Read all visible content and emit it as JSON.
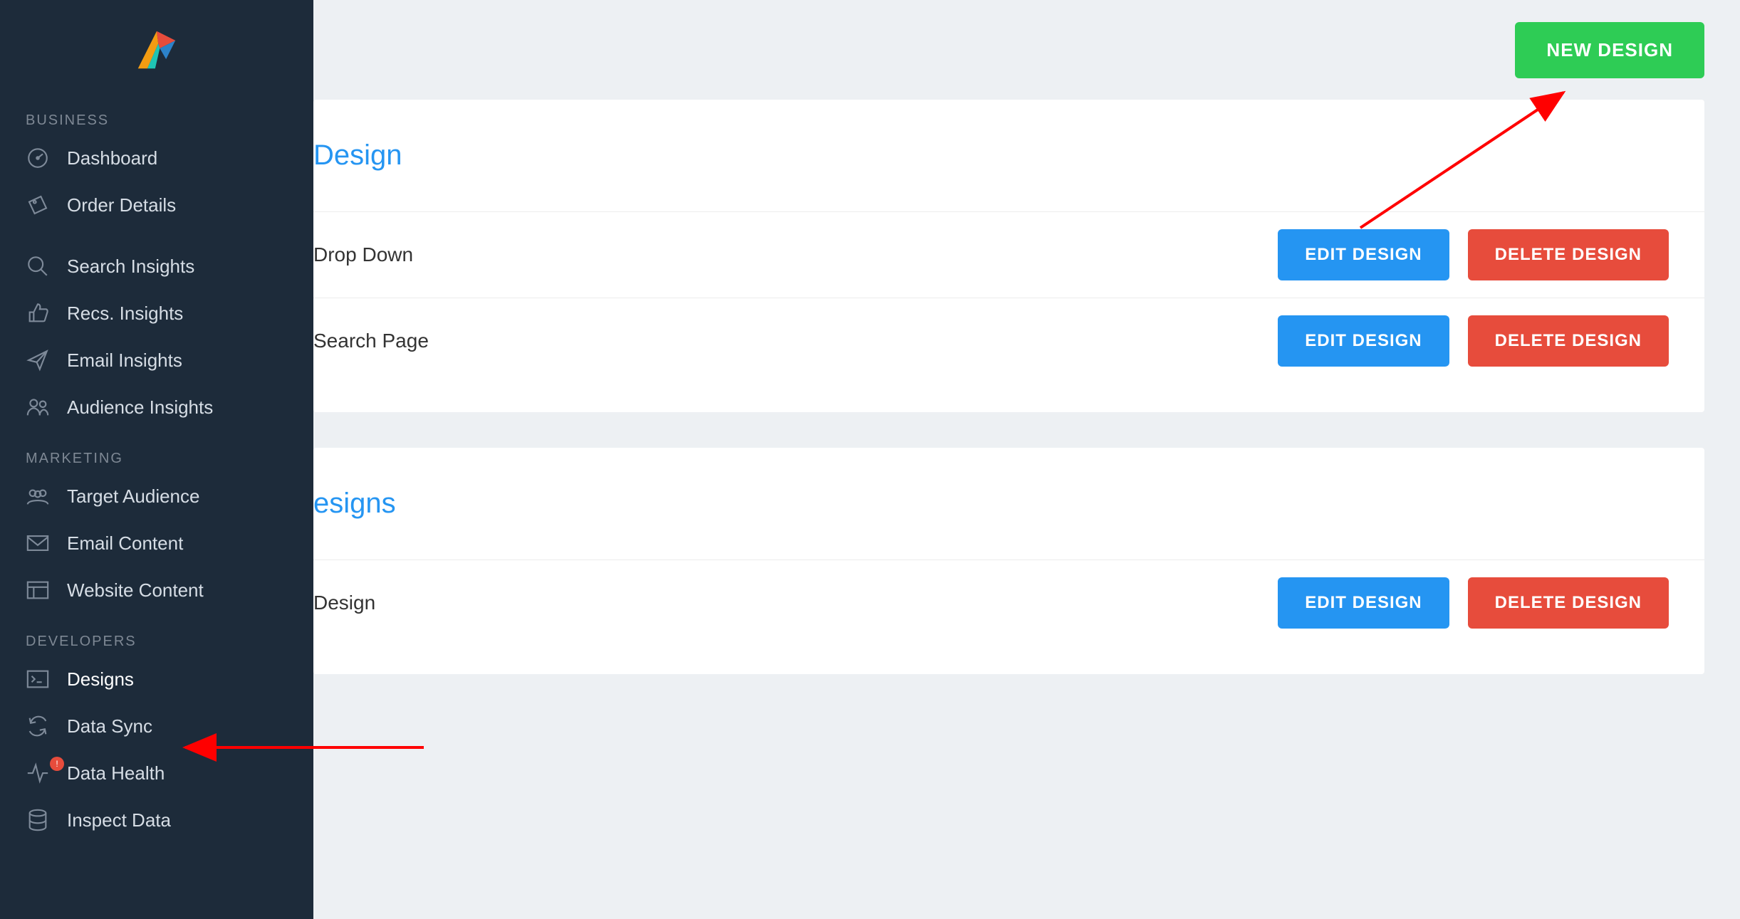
{
  "sidebar": {
    "sections": [
      {
        "label": "BUSINESS",
        "items": [
          {
            "label": "Dashboard",
            "icon": "gauge-icon"
          },
          {
            "label": "Order Details",
            "icon": "tag-icon"
          },
          {
            "label": "Search Insights",
            "icon": "search-icon"
          },
          {
            "label": "Recs. Insights",
            "icon": "thumbs-up-icon"
          },
          {
            "label": "Email Insights",
            "icon": "paper-plane-icon"
          },
          {
            "label": "Audience Insights",
            "icon": "people-icon"
          }
        ]
      },
      {
        "label": "MARKETING",
        "items": [
          {
            "label": "Target Audience",
            "icon": "group-icon"
          },
          {
            "label": "Email Content",
            "icon": "envelope-icon"
          },
          {
            "label": "Website Content",
            "icon": "layout-icon"
          }
        ]
      },
      {
        "label": "DEVELOPERS",
        "items": [
          {
            "label": "Designs",
            "icon": "terminal-icon",
            "active": true
          },
          {
            "label": "Data Sync",
            "icon": "sync-icon"
          },
          {
            "label": "Data Health",
            "icon": "activity-icon",
            "alert": "!"
          },
          {
            "label": "Inspect Data",
            "icon": "database-icon"
          }
        ]
      }
    ]
  },
  "topbar": {
    "new_design_label": "NEW DESIGN"
  },
  "panels": [
    {
      "title": "Design",
      "rows": [
        {
          "name": "Drop Down",
          "edit": "EDIT DESIGN",
          "delete": "DELETE DESIGN"
        },
        {
          "name": "Search Page",
          "edit": "EDIT DESIGN",
          "delete": "DELETE DESIGN"
        }
      ]
    },
    {
      "title": "esigns",
      "rows": [
        {
          "name": "Design",
          "edit": "EDIT DESIGN",
          "delete": "DELETE DESIGN"
        }
      ]
    }
  ]
}
